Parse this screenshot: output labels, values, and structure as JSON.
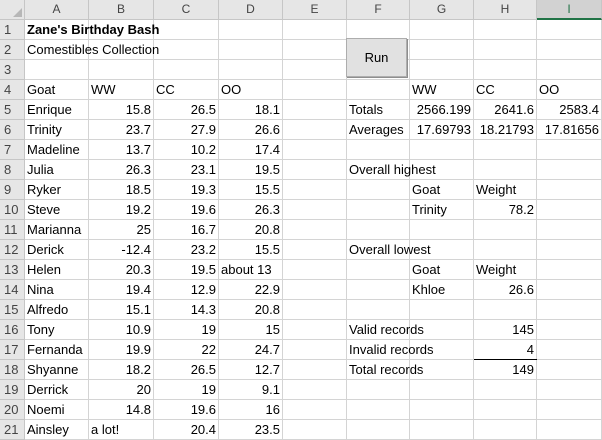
{
  "columns": [
    "A",
    "B",
    "C",
    "D",
    "E",
    "F",
    "G",
    "H",
    "I"
  ],
  "rows": [
    "1",
    "2",
    "3",
    "4",
    "5",
    "6",
    "7",
    "8",
    "9",
    "10",
    "11",
    "12",
    "13",
    "14",
    "15",
    "16",
    "17",
    "18",
    "19",
    "20",
    "21"
  ],
  "run_button": {
    "label": "Run"
  },
  "title": "Zane's Birthday Bash",
  "subtitle": "Comestibles Collection",
  "table": {
    "headers": [
      "Goat",
      "WW",
      "CC",
      "OO"
    ],
    "rows": [
      [
        "Enrique",
        "15.8",
        "26.5",
        "18.1"
      ],
      [
        "Trinity",
        "23.7",
        "27.9",
        "26.6"
      ],
      [
        "Madeline",
        "13.7",
        "10.2",
        "17.4"
      ],
      [
        "Julia",
        "26.3",
        "23.1",
        "19.5"
      ],
      [
        "Ryker",
        "18.5",
        "19.3",
        "15.5"
      ],
      [
        "Steve",
        "19.2",
        "19.6",
        "26.3"
      ],
      [
        "Marianna",
        "25",
        "16.7",
        "20.8"
      ],
      [
        "Derick",
        "-12.4",
        "23.2",
        "15.5"
      ],
      [
        "Helen",
        "20.3",
        "19.5",
        "about 13"
      ],
      [
        "Nina",
        "19.4",
        "12.9",
        "22.9"
      ],
      [
        "Alfredo",
        "15.1",
        "14.3",
        "20.8"
      ],
      [
        "Tony",
        "10.9",
        "19",
        "15"
      ],
      [
        "Fernanda",
        "19.9",
        "22",
        "24.7"
      ],
      [
        "Shyanne",
        "18.2",
        "26.5",
        "12.7"
      ],
      [
        "Derrick",
        "20",
        "19",
        "9.1"
      ],
      [
        "Noemi",
        "14.8",
        "19.6",
        "16"
      ],
      [
        "Ainsley",
        "a lot!",
        "20.4",
        "23.5"
      ]
    ]
  },
  "summary": {
    "headers": [
      "WW",
      "CC",
      "OO"
    ],
    "totals_label": "Totals",
    "totals": [
      "2566.199",
      "2641.6",
      "2583.4"
    ],
    "averages_label": "Averages",
    "averages": [
      "17.69793",
      "18.21793",
      "17.81656"
    ],
    "highest_label": "Overall highest",
    "highest_goat_label": "Goat",
    "highest_weight_label": "Weight",
    "highest_goat": "Trinity",
    "highest_weight": "78.2",
    "lowest_label": "Overall lowest",
    "lowest_goat_label": "Goat",
    "lowest_weight_label": "Weight",
    "lowest_goat": "Khloe",
    "lowest_weight": "26.6",
    "valid_label": "Valid records",
    "valid": "145",
    "invalid_label": "Invalid records",
    "invalid": "4",
    "total_label": "Total records",
    "total": "149"
  }
}
